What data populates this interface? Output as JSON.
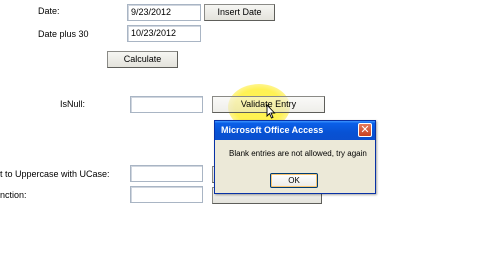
{
  "form": {
    "date_label": "Date:",
    "date_value": "9/23/2012",
    "insert_date_label": "Insert Date",
    "date_plus_label": "Date plus 30",
    "date_plus_value": "10/23/2012",
    "calculate_label": "Calculate",
    "isnull_label": "IsNull:",
    "isnull_value": "",
    "validate_label": "Validate Entry",
    "ucase_label": "t to Uppercase with UCase:",
    "ucase_value": "",
    "function_label": "nction:",
    "function_value": ""
  },
  "dialog": {
    "title": "Microsoft Office Access",
    "close_glyph": "✕",
    "message": "Blank entries are not allowed, try again",
    "ok_label": "OK"
  },
  "colors": {
    "titlebar": "#0852d4",
    "highlight": "#fff44a"
  }
}
